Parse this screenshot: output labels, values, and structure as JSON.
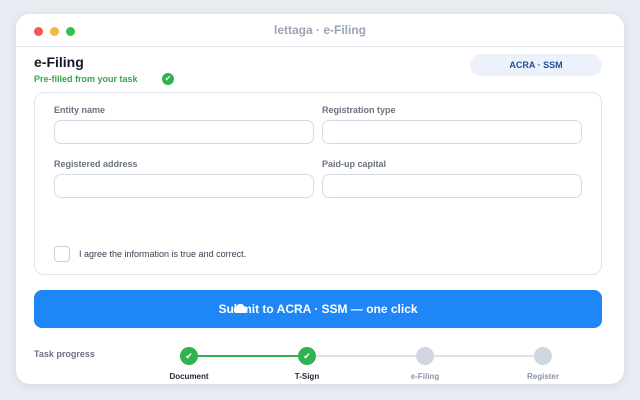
{
  "window": {
    "title": "lettaga · e-Filing"
  },
  "page": {
    "title": "e-Filing",
    "prefill_note": "Pre-filled from your task",
    "agency_chip": "ACRA · SSM"
  },
  "form": {
    "fields": [
      {
        "label": "Entity name",
        "value": ""
      },
      {
        "label": "Registration type",
        "value": ""
      },
      {
        "label": "Registered address",
        "value": ""
      },
      {
        "label": "Paid-up capital",
        "value": ""
      }
    ],
    "agree_label": "I agree the information is true and correct.",
    "agree_checked": false
  },
  "submit": {
    "label": "Submit to ACRA · SSM — one click"
  },
  "progress": {
    "label": "Task progress",
    "steps": [
      {
        "label": "Document",
        "status": "done"
      },
      {
        "label": "T-Sign",
        "status": "done"
      },
      {
        "label": "e-Filing",
        "status": "pending"
      },
      {
        "label": "Register",
        "status": "pending"
      }
    ]
  },
  "colors": {
    "accent": "#1f86f7",
    "success": "#2fb24f",
    "pending": "#cfd6e1"
  },
  "icons": {
    "check": "check-icon",
    "cloud": "cloud-upload-icon"
  }
}
